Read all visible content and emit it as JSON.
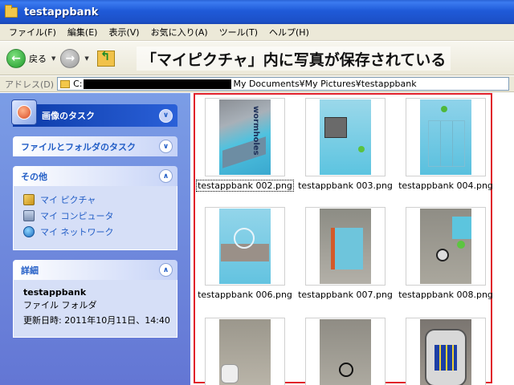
{
  "window": {
    "title": "testappbank"
  },
  "menu": [
    "ファイル(F)",
    "編集(E)",
    "表示(V)",
    "お気に入り(A)",
    "ツール(T)",
    "ヘルプ(H)"
  ],
  "toolbar": {
    "back_label": "戻る"
  },
  "caption": "「マイピクチャ」内に写真が保存されている",
  "address": {
    "label": "アドレス(D)",
    "drive": "C:",
    "path": "My Documents¥My Pictures¥testappbank"
  },
  "taskpane": {
    "image_tasks": {
      "title": "画像のタスク"
    },
    "file_tasks": {
      "title": "ファイルとフォルダのタスク"
    },
    "other": {
      "title": "その他",
      "links": [
        "マイ ピクチャ",
        "マイ コンピュータ",
        "マイ ネットワーク"
      ]
    },
    "details": {
      "title": "詳細",
      "name": "testappbank",
      "type": "ファイル フォルダ",
      "modified": "更新日時: 2011年10月11日、14:40"
    }
  },
  "files": [
    "testappbank 002.png",
    "testappbank 003.png",
    "testappbank 004.png",
    "testappbank 006.png",
    "testappbank 007.png",
    "testappbank 008.png",
    "",
    "",
    ""
  ],
  "colors": {
    "highlight_border": "#e0202a",
    "titlebar": "#1f5ad8",
    "task_link": "#215dc6"
  }
}
